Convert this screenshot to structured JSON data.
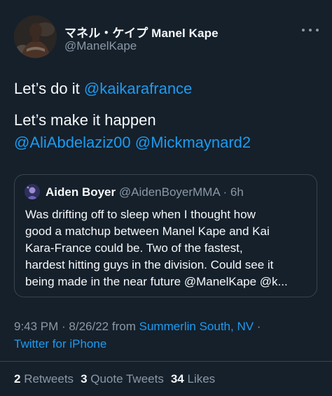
{
  "author": {
    "display_name": "マネル・ケイプ Manel Kape",
    "handle": "@ManelKape",
    "avatar": "profile-photo"
  },
  "tweet": {
    "line1_text": "Let’s do it ",
    "line1_mention": "@kaikarafrance",
    "line2_text": "Let’s make it happen",
    "mention_ali": "@AliAbdelaziz00",
    "mention_mick": "@Mickmaynard2"
  },
  "quoted": {
    "display_name": "Aiden Boyer",
    "handle": "@AidenBoyerMMA",
    "separator": " · ",
    "time_ago": "6h",
    "lines": [
      "Was drifting off to sleep when I thought how",
      "good a matchup between Manel Kape and Kai",
      "Kara-France could be. Two of the fastest,",
      "hardest hitting guys in the division. Could see it",
      "being made in the near future @ManelKape @k..."
    ]
  },
  "meta": {
    "time": "9:43 PM",
    "sep": " · ",
    "date": "8/26/22",
    "from": " from ",
    "location": "Summerlin South, NV",
    "sep2": " ·",
    "source": "Twitter for iPhone"
  },
  "stats": {
    "retweets_count": "2",
    "retweets_label": " Retweets",
    "quotes_count": "3",
    "quotes_label": " Quote Tweets",
    "likes_count": "34",
    "likes_label": " Likes"
  },
  "colors": {
    "background": "#15202b",
    "accent": "#1d9bf0",
    "text_primary": "#f7f9f9",
    "text_secondary": "#8b98a5",
    "border": "#38444d"
  }
}
